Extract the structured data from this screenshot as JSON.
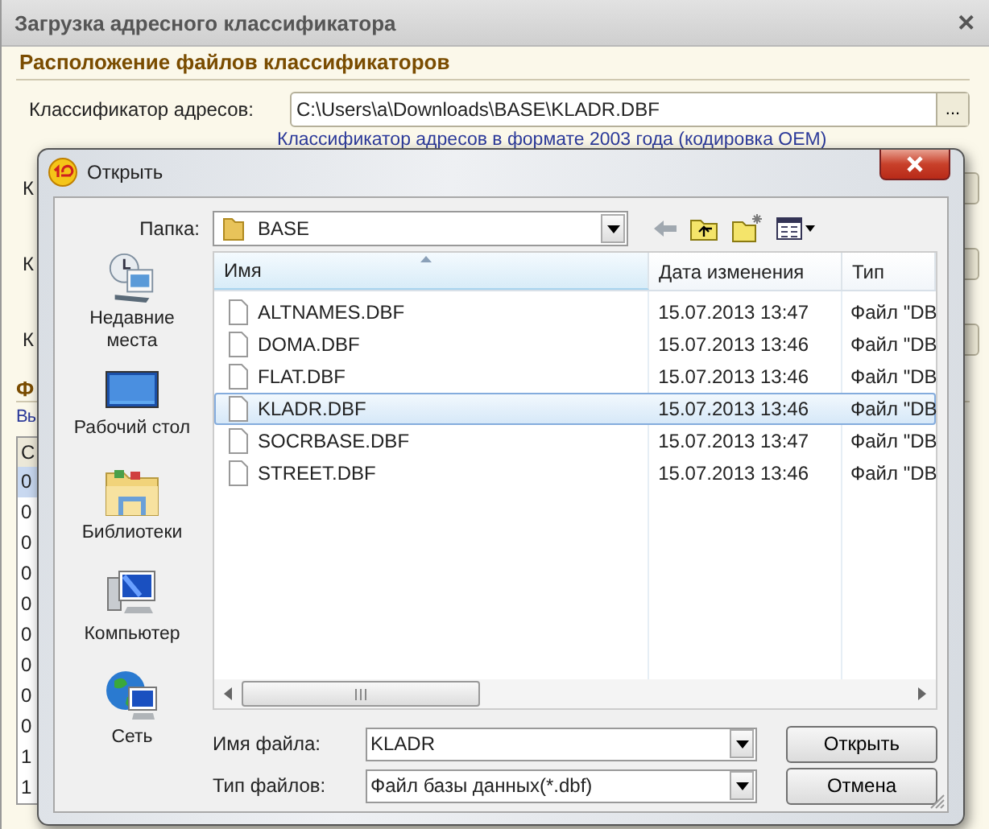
{
  "window": {
    "title": "Загрузка адресного классификатора",
    "close": "✕"
  },
  "section": {
    "title": "Расположение файлов классификаторов"
  },
  "address_field": {
    "label": "Классификатор адресов:",
    "value": "C:\\Users\\a\\Downloads\\BASE\\KLADR.DBF",
    "button": "...",
    "link": "Классификатор адресов в формате  2003 года  (кодировка OEM)"
  },
  "hidden_labels": [
    "К",
    "К",
    "К"
  ],
  "section_2": {
    "title": "Ф",
    "link": "Вы"
  },
  "table_column": {
    "header": "С",
    "cells": [
      {
        "text": "0",
        "selected": true
      },
      {
        "text": "0",
        "selected": false
      },
      {
        "text": "0",
        "selected": false
      },
      {
        "text": "0",
        "selected": false
      },
      {
        "text": "0",
        "selected": false
      },
      {
        "text": "0",
        "selected": false
      },
      {
        "text": "0",
        "selected": false
      },
      {
        "text": "0",
        "selected": false
      },
      {
        "text": "0",
        "selected": false
      },
      {
        "text": "1",
        "selected": false
      },
      {
        "text": "1",
        "selected": false
      }
    ]
  },
  "dialog": {
    "title": "Открыть",
    "folder_label": "Папка:",
    "folder": "BASE",
    "places": [
      {
        "label": "Недавние места",
        "kind": "recent"
      },
      {
        "label": "Рабочий стол",
        "kind": "desktop"
      },
      {
        "label": "Библиотеки",
        "kind": "libraries"
      },
      {
        "label": "Компьютер",
        "kind": "computer"
      },
      {
        "label": "Сеть",
        "kind": "network"
      }
    ],
    "columns": [
      "Имя",
      "Дата изменения",
      "Тип"
    ],
    "files": [
      {
        "name": "ALTNAMES.DBF",
        "date": "15.07.2013 13:47",
        "type": "Файл \"DB",
        "selected": false
      },
      {
        "name": "DOMA.DBF",
        "date": "15.07.2013 13:46",
        "type": "Файл \"DB",
        "selected": false
      },
      {
        "name": "FLAT.DBF",
        "date": "15.07.2013 13:46",
        "type": "Файл \"DB",
        "selected": false
      },
      {
        "name": "KLADR.DBF",
        "date": "15.07.2013 13:46",
        "type": "Файл \"DB",
        "selected": true
      },
      {
        "name": "SOCRBASE.DBF",
        "date": "15.07.2013 13:47",
        "type": "Файл \"DB",
        "selected": false
      },
      {
        "name": "STREET.DBF",
        "date": "15.07.2013 13:46",
        "type": "Файл \"DB",
        "selected": false
      }
    ],
    "file_name_label": "Имя файла:",
    "file_name": "KLADR",
    "file_type_label": "Тип файлов:",
    "file_type": "Файл базы данных(*.dbf)",
    "open_button": "Открыть",
    "cancel_button": "Отмена"
  }
}
